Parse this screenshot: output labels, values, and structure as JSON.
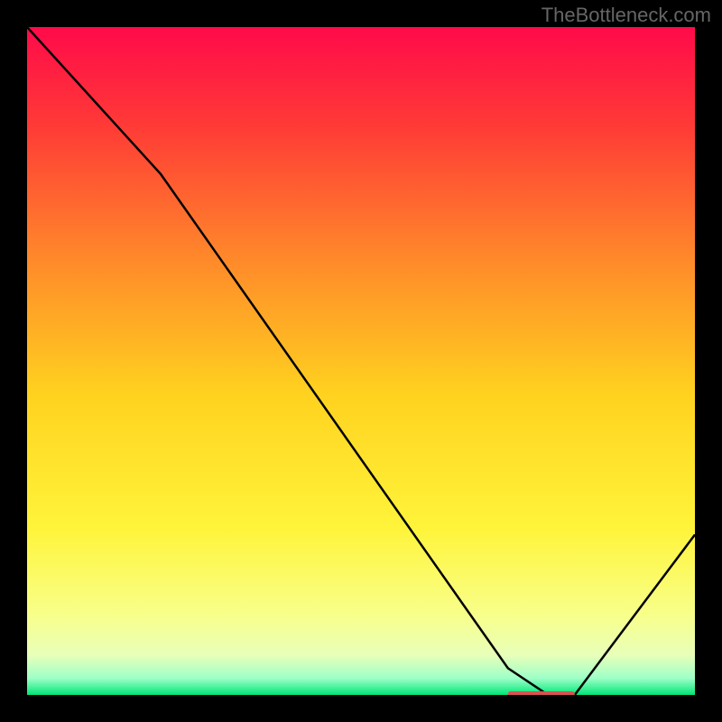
{
  "watermark": "TheBottleneck.com",
  "chart_data": {
    "type": "line",
    "title": "",
    "xlabel": "",
    "ylabel": "",
    "xlim": [
      0,
      100
    ],
    "ylim": [
      0,
      100
    ],
    "x": [
      0,
      20,
      72,
      78,
      82,
      100
    ],
    "values": [
      100,
      78,
      4,
      0,
      0,
      24
    ],
    "marker": {
      "x_start": 72,
      "x_end": 82,
      "y": 0,
      "color": "#d9534f"
    },
    "gradient_stops": [
      {
        "offset": 0.0,
        "color": "#ff0a4a"
      },
      {
        "offset": 0.15,
        "color": "#ff3b36"
      },
      {
        "offset": 0.35,
        "color": "#ff8a2a"
      },
      {
        "offset": 0.55,
        "color": "#ffd21f"
      },
      {
        "offset": 0.75,
        "color": "#fff43a"
      },
      {
        "offset": 0.88,
        "color": "#f8ff8a"
      },
      {
        "offset": 0.94,
        "color": "#e8ffb8"
      },
      {
        "offset": 0.975,
        "color": "#9effc8"
      },
      {
        "offset": 1.0,
        "color": "#00e676"
      }
    ]
  }
}
